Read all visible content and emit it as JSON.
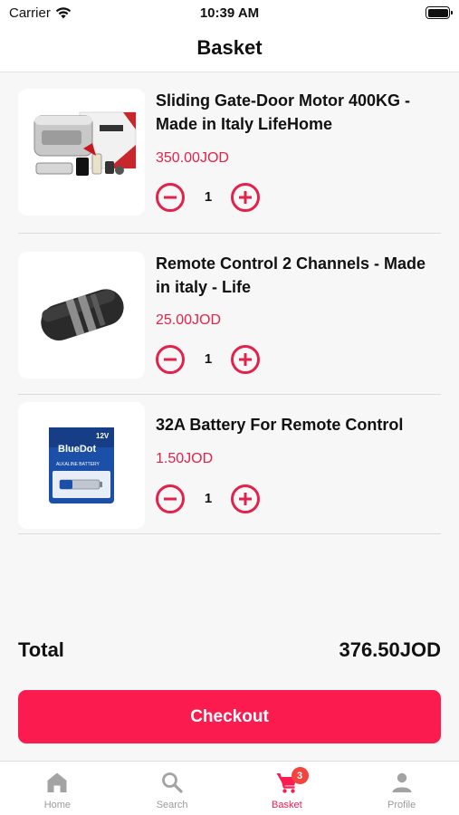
{
  "status_bar": {
    "carrier": "Carrier",
    "time": "10:39 AM"
  },
  "header": {
    "title": "Basket"
  },
  "items": [
    {
      "name": "Sliding Gate-Door Motor 400KG - Made in Italy LifeHome",
      "price": "350.00JOD",
      "quantity": "1",
      "image_icon": "gate-motor-product-icon"
    },
    {
      "name": "Remote Control 2 Channels - Made in italy - Life",
      "price": "25.00JOD",
      "quantity": "1",
      "image_icon": "remote-control-product-icon"
    },
    {
      "name": "32A Battery For Remote Control",
      "price": "1.50JOD",
      "quantity": "1",
      "image_icon": "battery-product-icon",
      "image_text": {
        "brand": "BlueDot",
        "voltage": "12V",
        "type": "ALKALINE BATTERY"
      }
    }
  ],
  "summary": {
    "total_label": "Total",
    "total_value": "376.50JOD"
  },
  "checkout": {
    "label": "Checkout"
  },
  "tab_bar": {
    "tabs": [
      {
        "label": "Home",
        "icon": "home-icon"
      },
      {
        "label": "Search",
        "icon": "search-icon"
      },
      {
        "label": "Basket",
        "icon": "cart-icon",
        "badge": "3",
        "active": true
      },
      {
        "label": "Profile",
        "icon": "person-icon"
      }
    ]
  },
  "colors": {
    "accent": "#fc1b4f",
    "price": "#e3224b",
    "badge": "#f2453d",
    "inactive": "#9a9a9a"
  }
}
